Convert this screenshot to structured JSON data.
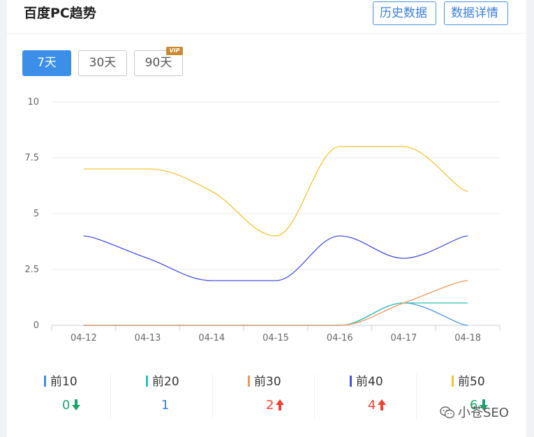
{
  "header": {
    "title": "百度PC趋势",
    "history_button": "历史数据",
    "detail_button": "数据详情"
  },
  "range_tabs": [
    {
      "label": "7天",
      "active": true
    },
    {
      "label": "30天",
      "active": false
    },
    {
      "label": "90天",
      "active": false,
      "badge": "VIP"
    }
  ],
  "chart_data": {
    "type": "line",
    "x": [
      "04-12",
      "04-13",
      "04-14",
      "04-15",
      "04-16",
      "04-17",
      "04-18"
    ],
    "yticks": [
      "0",
      "2.5",
      "5",
      "7.5",
      "10"
    ],
    "ylim": [
      0,
      10
    ],
    "grid": true,
    "series": [
      {
        "name": "前10",
        "color": "#4a90e2",
        "values": [
          0,
          0,
          0,
          0,
          0,
          1,
          0
        ]
      },
      {
        "name": "前20",
        "color": "#2ec4b6",
        "values": [
          0,
          0,
          0,
          0,
          0,
          1,
          1
        ]
      },
      {
        "name": "前30",
        "color": "#f0955a",
        "values": [
          0,
          0,
          0,
          0,
          0,
          1,
          2
        ]
      },
      {
        "name": "前40",
        "color": "#4b4fd8",
        "values": [
          4,
          3,
          2,
          2,
          4,
          3,
          4
        ]
      },
      {
        "name": "前50",
        "color": "#f5c233",
        "values": [
          7,
          7,
          6,
          4,
          8,
          8,
          6
        ]
      }
    ]
  },
  "legend": [
    {
      "label": "前10",
      "color": "#3b8fe8",
      "value": "0",
      "value_color": "#1aa36a",
      "trend": "down",
      "trend_color": "#1aa36a"
    },
    {
      "label": "前20",
      "color": "#2ec4b6",
      "value": "1",
      "value_color": "#3b7fd8",
      "trend": "none"
    },
    {
      "label": "前30",
      "color": "#f0955a",
      "value": "2",
      "value_color": "#f04134",
      "trend": "up",
      "trend_color": "#f04134"
    },
    {
      "label": "前40",
      "color": "#4b4fd8",
      "value": "4",
      "value_color": "#f04134",
      "trend": "up",
      "trend_color": "#f04134"
    },
    {
      "label": "前50",
      "color": "#f5c233",
      "value": "6",
      "value_color": "#1aa36a",
      "trend": "down",
      "trend_color": "#1aa36a"
    }
  ],
  "watermark": {
    "text": "小苍SEO",
    "icon": "wechat-icon"
  }
}
